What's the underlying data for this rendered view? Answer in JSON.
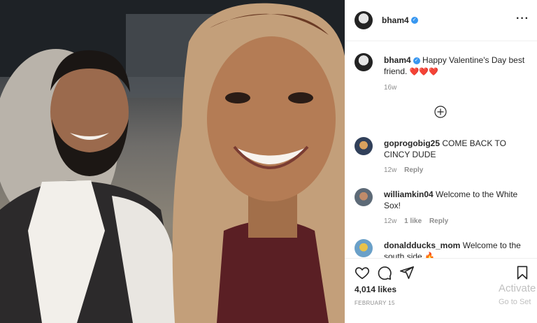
{
  "post": {
    "username": "bham4",
    "more_icon": "more-horizontal-icon",
    "caption_user": "bham4",
    "caption_text": "Happy Valentine's Day best friend.",
    "caption_hearts": "❤️❤️❤️",
    "caption_time": "16w",
    "load_more_icon": "plus-circle-icon"
  },
  "comments": [
    {
      "user": "goprogobig25",
      "text": "COME BACK TO CINCY DUDE",
      "time": "12w",
      "likes": "",
      "reply": "Reply"
    },
    {
      "user": "williamkin04",
      "text": "Welcome to the White Sox!",
      "time": "12w",
      "likes": "1 like",
      "reply": "Reply"
    },
    {
      "user": "donaldducks_mom",
      "text": "Welcome to the south side",
      "emoji": "🔥"
    }
  ],
  "actions": {
    "like_icon": "heart-icon",
    "comment_icon": "comment-icon",
    "share_icon": "share-icon",
    "save_icon": "bookmark-icon",
    "likes": "4,014 likes",
    "date": "FEBRUARY 15"
  },
  "watermark": {
    "line1": "Activate",
    "line2": "Go to Set"
  },
  "colors": {
    "verified": "#3897f0",
    "heart": "#ed1c24",
    "muted": "#8e8e8e",
    "text": "#262626"
  }
}
